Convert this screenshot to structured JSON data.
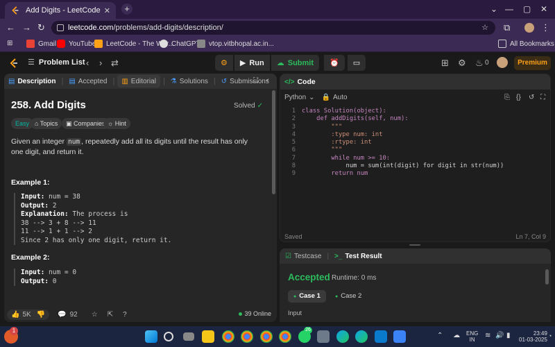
{
  "browser": {
    "tab_title": "Add Digits - LeetCode",
    "tab_close": "✕",
    "new_tab": "+",
    "url_host": "leetcode.com",
    "url_path": "/problems/add-digits/description/",
    "bookmarks": [
      {
        "label": "Gmail"
      },
      {
        "label": "YouTube"
      },
      {
        "label": "LeetCode - The Wor..."
      },
      {
        "label": "ChatGPT"
      },
      {
        "label": "vtop.vitbhopal.ac.in..."
      }
    ],
    "all_bookmarks": "All Bookmarks"
  },
  "header": {
    "problem_list": "Problem List",
    "run": "Run",
    "submit": "Submit",
    "streak": "0",
    "premium": "Premium"
  },
  "left_tabs": [
    {
      "label": "Description"
    },
    {
      "label": "Accepted"
    },
    {
      "label": "Editorial"
    },
    {
      "label": "Solutions"
    },
    {
      "label": "Submissions"
    }
  ],
  "problem": {
    "title": "258. Add Digits",
    "status": "Solved",
    "tags": {
      "easy": "Easy",
      "topics": "Topics",
      "companies": "Companies",
      "hint": "Hint"
    },
    "desc_before": "Given an integer ",
    "desc_code": "num",
    "desc_after": ", repeatedly add all its digits until the result has only one digit, and return it.",
    "example1_title": "Example 1:",
    "example1": {
      "input_label": "Input:",
      "input": " num = 38",
      "output_label": "Output:",
      "output": " 2",
      "expl_label": "Explanation:",
      "expl": " The process is",
      "line1": "38 --> 3 + 8 --> 11",
      "line2": "11 --> 1 + 1 --> 2",
      "line3": "Since 2 has only one digit, return it."
    },
    "example2_title": "Example 2:",
    "example2": {
      "input_label": "Input:",
      "input": " num = 0",
      "output_label": "Output:",
      "output": " 0"
    }
  },
  "footer": {
    "likes": "5K",
    "comments": "92",
    "online": "39 Online"
  },
  "code": {
    "tab": "Code",
    "language": "Python",
    "mode": "Auto",
    "lines": [
      "class Solution(object):",
      "    def addDigits(self, num):",
      "        \"\"\"",
      "        :type num: int",
      "        :rtype: int",
      "        \"\"\"",
      "        while num >= 10:",
      "            num = sum(int(digit) for digit in str(num))",
      "        return num"
    ],
    "saved": "Saved",
    "cursor": "Ln 7, Col 9"
  },
  "tests": {
    "testcase_tab": "Testcase",
    "result_tab": "Test Result",
    "verdict": "Accepted",
    "runtime": "Runtime: 0 ms",
    "case1": "Case 1",
    "case2": "Case 2",
    "input_label": "Input"
  },
  "taskbar": {
    "lang_top": "ENG",
    "lang_bottom": "IN",
    "time": "23:49",
    "date": "01-03-2025",
    "badge": "26",
    "weather_badge": "1"
  },
  "colors": {
    "accent_green": "#2cbb5d",
    "premium_orange": "#ffa116",
    "easy_teal": "#00b8a3"
  }
}
